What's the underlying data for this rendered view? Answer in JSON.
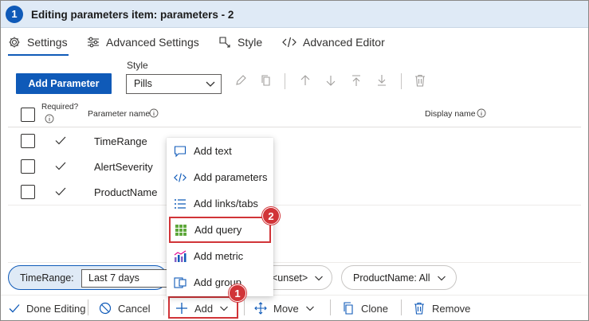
{
  "header": {
    "step": "1",
    "title": "Editing parameters item: parameters - 2"
  },
  "tabs": [
    {
      "label": "Settings",
      "icon": "gear-icon",
      "active": true
    },
    {
      "label": "Advanced Settings",
      "icon": "sliders-icon"
    },
    {
      "label": "Style",
      "icon": "style-icon"
    },
    {
      "label": "Advanced Editor",
      "icon": "code-icon"
    }
  ],
  "toolbar": {
    "add_parameter_label": "Add Parameter",
    "style_label": "Style",
    "style_value": "Pills",
    "icons": [
      "edit-icon",
      "copy-icon",
      "move-up-icon",
      "move-down-icon",
      "move-top-icon",
      "move-bottom-icon",
      "delete-icon"
    ]
  },
  "table": {
    "headers": {
      "required": "Required?",
      "parameter_name": "Parameter name",
      "display_name": "Display name"
    },
    "rows": [
      {
        "name": "TimeRange",
        "required": true
      },
      {
        "name": "AlertSeverity",
        "required": true
      },
      {
        "name": "ProductName",
        "required": true
      }
    ]
  },
  "params_bar": {
    "timerange_label": "TimeRange:",
    "timerange_value": "Last 7 days",
    "unset_value": "<unset>",
    "product_label": "ProductName: All"
  },
  "menu": {
    "items": [
      {
        "label": "Add text",
        "icon": "text-icon"
      },
      {
        "label": "Add parameters",
        "icon": "code-icon"
      },
      {
        "label": "Add links/tabs",
        "icon": "list-icon"
      },
      {
        "label": "Add query",
        "icon": "grid-icon",
        "highlighted": true
      },
      {
        "label": "Add metric",
        "icon": "metric-icon"
      },
      {
        "label": "Add group",
        "icon": "group-icon"
      }
    ]
  },
  "commands": {
    "done_editing": "Done Editing",
    "cancel": "Cancel",
    "add": "Add",
    "move": "Move",
    "clone": "Clone",
    "remove": "Remove"
  },
  "callouts": {
    "first": "1",
    "second": "2"
  },
  "colors": {
    "accent": "#0f5ab8",
    "header_bg": "#dfeaf6",
    "highlight": "#d13438"
  }
}
